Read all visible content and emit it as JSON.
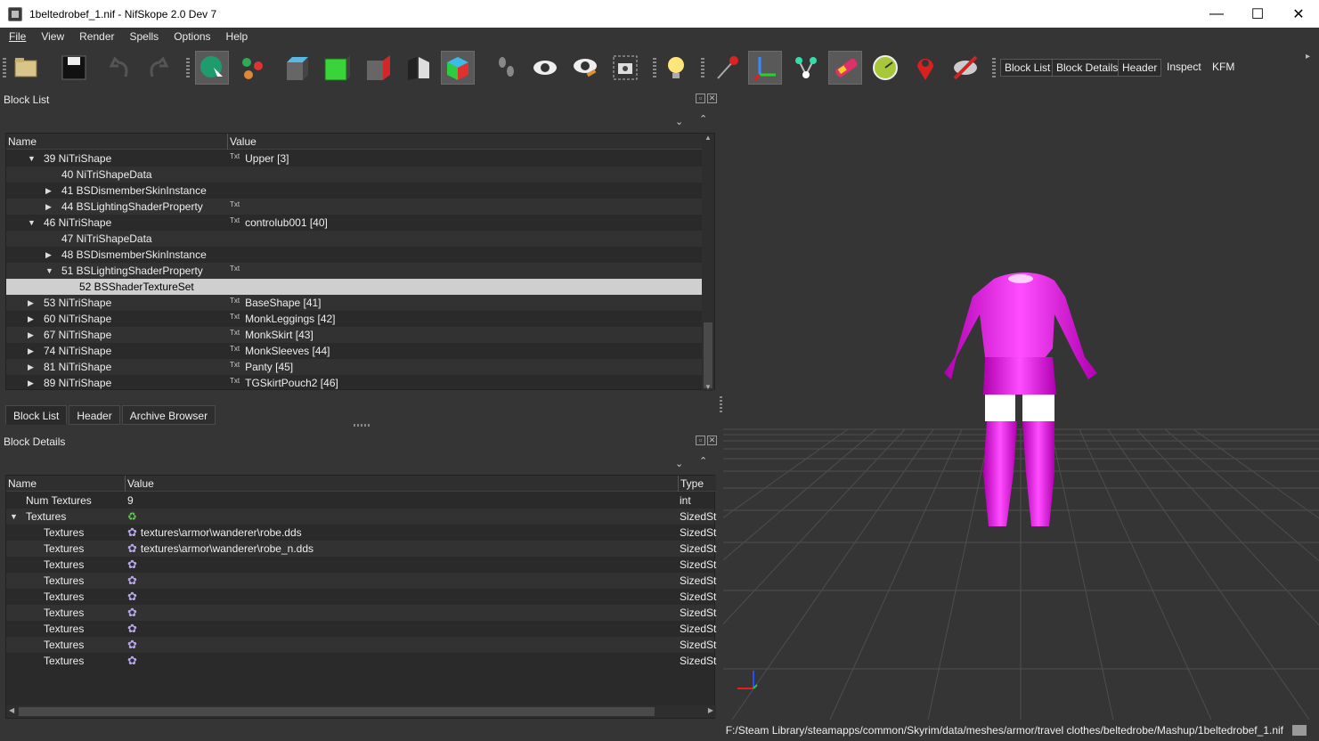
{
  "window": {
    "title": "1beltedrobef_1.nif - NifSkope 2.0 Dev 7",
    "minimize": "—",
    "maximize": "☐",
    "close": "✕"
  },
  "menu": [
    "File",
    "View",
    "Render",
    "Spells",
    "Options",
    "Help"
  ],
  "toolbar": {
    "buttons": [
      "open-icon",
      "save-icon",
      "undo-icon",
      "redo-icon",
      "select-icon",
      "select-connected-icon",
      "view-top-icon",
      "view-front-icon",
      "view-side-icon",
      "view-walk-icon",
      "view-user-icon",
      "footprints-icon",
      "eye-icon",
      "eye-paint-icon",
      "screenshot-icon",
      "light-bulb-icon",
      "vertex-icon",
      "axes-icon",
      "nodes-icon",
      "havok-icon",
      "constraints-icon",
      "markers-icon",
      "hide-icon"
    ],
    "dock_buttons": [
      "Block List",
      "Block Details",
      "Header",
      "Inspect",
      "KFM"
    ]
  },
  "block_list": {
    "title": "Block List",
    "columns": [
      "Name",
      "Value"
    ],
    "rows": [
      {
        "indent": 0,
        "arrow": "down",
        "name": "39 NiTriShape",
        "txt": true,
        "value": "Upper [3]"
      },
      {
        "indent": 1,
        "arrow": "",
        "name": "40 NiTriShapeData",
        "txt": false,
        "value": ""
      },
      {
        "indent": 1,
        "arrow": "right",
        "name": "41 BSDismemberSkinInstance",
        "txt": false,
        "value": ""
      },
      {
        "indent": 1,
        "arrow": "right",
        "name": "44 BSLightingShaderProperty",
        "txt": true,
        "value": ""
      },
      {
        "indent": 0,
        "arrow": "down",
        "name": "46 NiTriShape",
        "txt": true,
        "value": "controlub001 [40]"
      },
      {
        "indent": 1,
        "arrow": "",
        "name": "47 NiTriShapeData",
        "txt": false,
        "value": ""
      },
      {
        "indent": 1,
        "arrow": "right",
        "name": "48 BSDismemberSkinInstance",
        "txt": false,
        "value": ""
      },
      {
        "indent": 1,
        "arrow": "down",
        "name": "51 BSLightingShaderProperty",
        "txt": true,
        "value": ""
      },
      {
        "indent": 2,
        "arrow": "",
        "name": "52 BSShaderTextureSet",
        "txt": false,
        "value": "",
        "selected": true
      },
      {
        "indent": 0,
        "arrow": "right",
        "name": "53 NiTriShape",
        "txt": true,
        "value": "BaseShape [41]"
      },
      {
        "indent": 0,
        "arrow": "right",
        "name": "60 NiTriShape",
        "txt": true,
        "value": "MonkLeggings [42]"
      },
      {
        "indent": 0,
        "arrow": "right",
        "name": "67 NiTriShape",
        "txt": true,
        "value": "MonkSkirt [43]"
      },
      {
        "indent": 0,
        "arrow": "right",
        "name": "74 NiTriShape",
        "txt": true,
        "value": "MonkSleeves [44]"
      },
      {
        "indent": 0,
        "arrow": "right",
        "name": "81 NiTriShape",
        "txt": true,
        "value": "Panty [45]"
      },
      {
        "indent": 0,
        "arrow": "right",
        "name": "89 NiTriShape",
        "txt": true,
        "value": "TGSkirtPouch2 [46]"
      }
    ],
    "tabs": [
      "Block List",
      "Header",
      "Archive Browser"
    ],
    "txt_label": "Txt"
  },
  "block_details": {
    "title": "Block Details",
    "columns": [
      "Name",
      "Value",
      "Type"
    ],
    "rows": [
      {
        "name": "Num Textures",
        "indent": 0,
        "arrow": "",
        "icon": "",
        "value": "9",
        "type": "int"
      },
      {
        "name": "Textures",
        "indent": 0,
        "arrow": "down",
        "icon": "refresh-icon",
        "value": "",
        "type": "SizedSt"
      },
      {
        "name": "Textures",
        "indent": 1,
        "arrow": "",
        "icon": "gear-icon",
        "value": "textures\\armor\\wanderer\\robe.dds",
        "type": "SizedSt"
      },
      {
        "name": "Textures",
        "indent": 1,
        "arrow": "",
        "icon": "gear-icon",
        "value": "textures\\armor\\wanderer\\robe_n.dds",
        "type": "SizedSt"
      },
      {
        "name": "Textures",
        "indent": 1,
        "arrow": "",
        "icon": "gear-icon",
        "value": "",
        "type": "SizedSt"
      },
      {
        "name": "Textures",
        "indent": 1,
        "arrow": "",
        "icon": "gear-icon",
        "value": "",
        "type": "SizedSt"
      },
      {
        "name": "Textures",
        "indent": 1,
        "arrow": "",
        "icon": "gear-icon",
        "value": "",
        "type": "SizedSt"
      },
      {
        "name": "Textures",
        "indent": 1,
        "arrow": "",
        "icon": "gear-icon",
        "value": "",
        "type": "SizedSt"
      },
      {
        "name": "Textures",
        "indent": 1,
        "arrow": "",
        "icon": "gear-icon",
        "value": "",
        "type": "SizedSt"
      },
      {
        "name": "Textures",
        "indent": 1,
        "arrow": "",
        "icon": "gear-icon",
        "value": "",
        "type": "SizedSt"
      },
      {
        "name": "Textures",
        "indent": 1,
        "arrow": "",
        "icon": "gear-icon",
        "value": "",
        "type": "SizedSt"
      }
    ]
  },
  "status": {
    "path": "F:/Steam Library/steamapps/common/Skyrim/data/meshes/armor/travel clothes/beltedrobe/Mashup/1beltedrobef_1.nif"
  },
  "colors": {
    "model": "#ff1aff",
    "grid": "#555555",
    "bg": "#353535"
  }
}
